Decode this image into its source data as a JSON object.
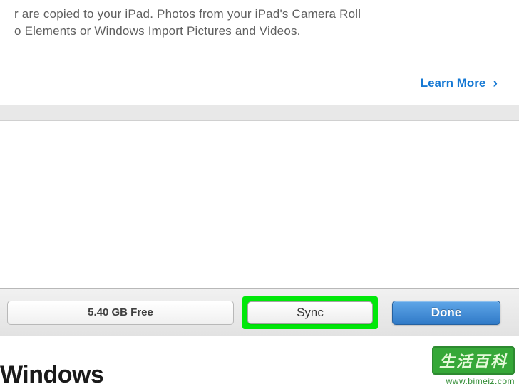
{
  "info": {
    "line1": "r are copied to your iPad. Photos from your iPad's Camera Roll",
    "line2": "o Elements or Windows Import Pictures and Videos.",
    "learn_more": "Learn More"
  },
  "bottom": {
    "storage": "5.40 GB Free",
    "sync_label": "Sync",
    "done_label": "Done"
  },
  "footer": {
    "caption": "Windows"
  },
  "watermark": {
    "zh": "生活百科",
    "url": "www.bimeiz.com"
  }
}
